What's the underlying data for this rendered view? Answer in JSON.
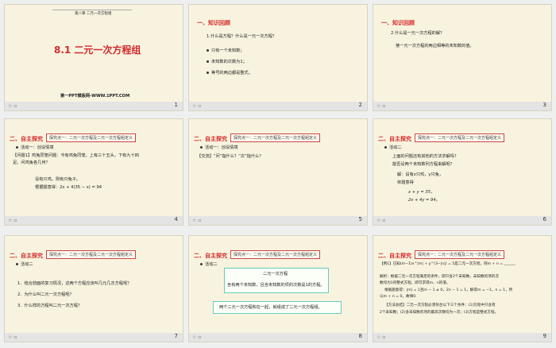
{
  "slides": [
    {
      "num": "1",
      "chapter": "第八章 二元一次方程组",
      "title": "8.1 二元一次方程组",
      "footer": "第一PPT模板网-WWW.1PPT.COM"
    },
    {
      "num": "2",
      "heading": "一、知识回顾",
      "q": "1.什么是方程？什么是一元一次方程？",
      "items": [
        "只有一个未知数；",
        "未知数的次数为1；",
        "等号的两边都是整式。"
      ]
    },
    {
      "num": "3",
      "heading": "一、知识回顾",
      "q": "2.什么是一元一次方程的解？",
      "a": "使一元一次方程的两边相等的未知数的值。"
    },
    {
      "num": "4",
      "heading": "二、自主探究",
      "tag": "探究点一：二元一次方程及二元一次方程组定义",
      "activity": "活动一：创设情境",
      "lines": [
        "【问题1】鸡兔同笼问题：今有鸡兔同笼，上有三十五头，下有九十四",
        "足。问鸡兔各几何？",
        "设有只鸡，则有只兔子。",
        "根据题意得：2x + 4(35 − x) = 94"
      ]
    },
    {
      "num": "5",
      "heading": "二、自主探究",
      "tag": "探究点一：二元一次方程及二元一次方程组定义",
      "activity": "活动一：创设情境",
      "lines": [
        "【交流】“问”指什么？“次”指什么？"
      ]
    },
    {
      "num": "6",
      "heading": "二、自主探究",
      "tag": "探究点一：二元一次方程及二元一次方程组定义",
      "activity": "活动二",
      "lines": [
        "上面的问题还有其他的方法求解吗？",
        "能否设两个未知数列方程来解呢？",
        "解：设有x只鸡，y只兔，",
        "依题意得",
        "x + y = 35，",
        "2x + 4y = 94。"
      ]
    },
    {
      "num": "7",
      "heading": "二、自主探究",
      "tag": "探究点一：二元一次方程及二元一次方程组定义",
      "activity": "活动二",
      "lines": [
        "1．结合前面的复习情况，这两个方程应该叫几元几次方程呢？",
        "2．为什么叫二元一次方程呢？",
        "3．什么样的方程叫二元一次方程？"
      ]
    },
    {
      "num": "8",
      "heading": "二、自主探究",
      "tag": "探究点一：二元一次方程及二元一次方程组定义",
      "activity": "活动二",
      "box1_title": "二元一次方程",
      "box1_text": "含有两个未知数，且含未知数的项的次数是1的方程。",
      "box2_text": "两个二元一次方程和在一起，就组成了二元一次方程组。"
    },
    {
      "num": "9",
      "heading": "二、自主探究",
      "tag": "探究点一：二元一次方程及二元一次方程组定义",
      "lines": [
        "【例1】已知(m−1)x^|m| + y^(3−|n|) = 5是二元一次方程，则m + n = ______.",
        "解析：根据二元一次方程满足的条件，即只含2个未知数，未知数的项的次",
        "数均为1的整式方程，即可求得m、n的值。",
        "根据题意得：|m| = 1且m − 1 ≠ 0，2n − 1 = 1，解得m = −1，n = 1，所",
        "以m + n = 0，故填0.",
        "【方法总结】二元一次方程必须符合以下三个条件：(1)方程中只含有",
        "2个未知数；(2)含未知数的项的最高次数均为一次；(3)方程是整式方程。"
      ]
    }
  ]
}
